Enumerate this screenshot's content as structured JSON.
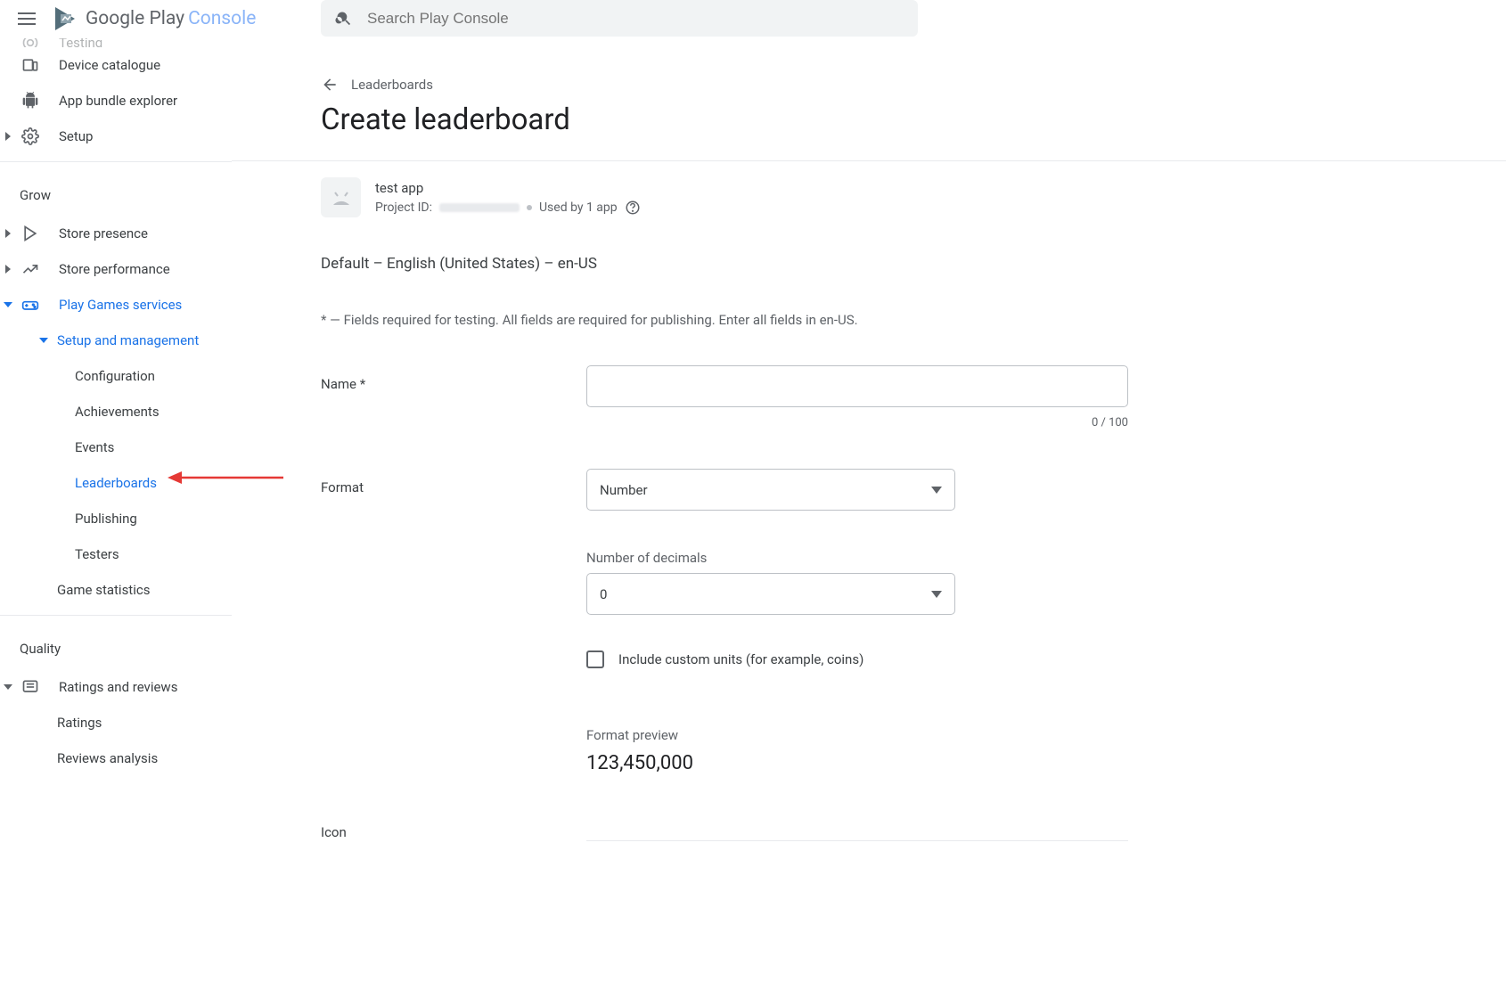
{
  "header": {
    "brand_part1": "Google Play",
    "brand_part2": "Console",
    "search_placeholder": "Search Play Console"
  },
  "sidebar": {
    "items_top": [
      {
        "label": "Testing",
        "icon": "target"
      },
      {
        "label": "Device catalogue",
        "icon": "devices"
      },
      {
        "label": "App bundle explorer",
        "icon": "bundle"
      },
      {
        "label": "Setup",
        "icon": "gear",
        "chevron": true
      }
    ],
    "section_grow": "Grow",
    "items_grow": [
      {
        "label": "Store presence",
        "icon": "store",
        "chevron": true
      },
      {
        "label": "Store performance",
        "icon": "trend",
        "chevron": true
      },
      {
        "label": "Play Games services",
        "icon": "games",
        "chevron": true,
        "active": true
      }
    ],
    "setup_mgmt": {
      "label": "Setup and management",
      "chevron": true
    },
    "setup_children": [
      {
        "label": "Configuration"
      },
      {
        "label": "Achievements"
      },
      {
        "label": "Events"
      },
      {
        "label": "Leaderboards",
        "active": true
      },
      {
        "label": "Publishing"
      },
      {
        "label": "Testers"
      }
    ],
    "game_stats": {
      "label": "Game statistics"
    },
    "section_quality": "Quality",
    "ratings_reviews": {
      "label": "Ratings and reviews",
      "chevron": true
    },
    "ratings_children": [
      {
        "label": "Ratings"
      },
      {
        "label": "Reviews analysis"
      }
    ]
  },
  "main": {
    "back_label": "Leaderboards",
    "title": "Create leaderboard",
    "app": {
      "name": "test app",
      "project_id_label": "Project ID:",
      "usage": "Used by 1 app"
    },
    "locale_line": "Default – English (United States) – en-US",
    "required_note": "* — Fields required for testing. All fields are required for publishing. Enter all fields in en-US.",
    "form": {
      "name_label": "Name  *",
      "name_value": "",
      "name_counter": "0 / 100",
      "format_label": "Format",
      "format_value": "Number",
      "decimals_label": "Number of decimals",
      "decimals_value": "0",
      "custom_units_label": "Include custom units (for example, coins)",
      "preview_label": "Format preview",
      "preview_value": "123,450,000",
      "icon_label": "Icon"
    }
  }
}
